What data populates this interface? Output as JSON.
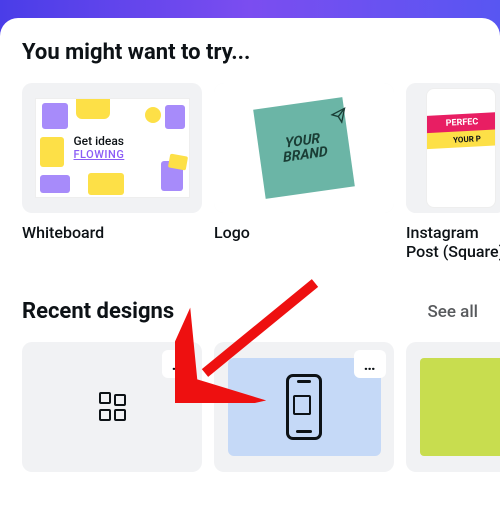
{
  "sections": {
    "try": {
      "title": "You might want to try...",
      "items": [
        {
          "label": "Whiteboard",
          "preview": {
            "line1": "Get ideas",
            "line2": "FLOWING"
          }
        },
        {
          "label": "Logo",
          "preview": {
            "line1": "YOUR",
            "line2": "BRAND"
          }
        },
        {
          "label": "Instagram Post (Square)",
          "preview": {
            "banner1": "PERFEC",
            "banner2": "YOUR P"
          }
        }
      ]
    },
    "recent": {
      "title": "Recent designs",
      "see_all": "See all",
      "more_glyph": "…"
    }
  }
}
